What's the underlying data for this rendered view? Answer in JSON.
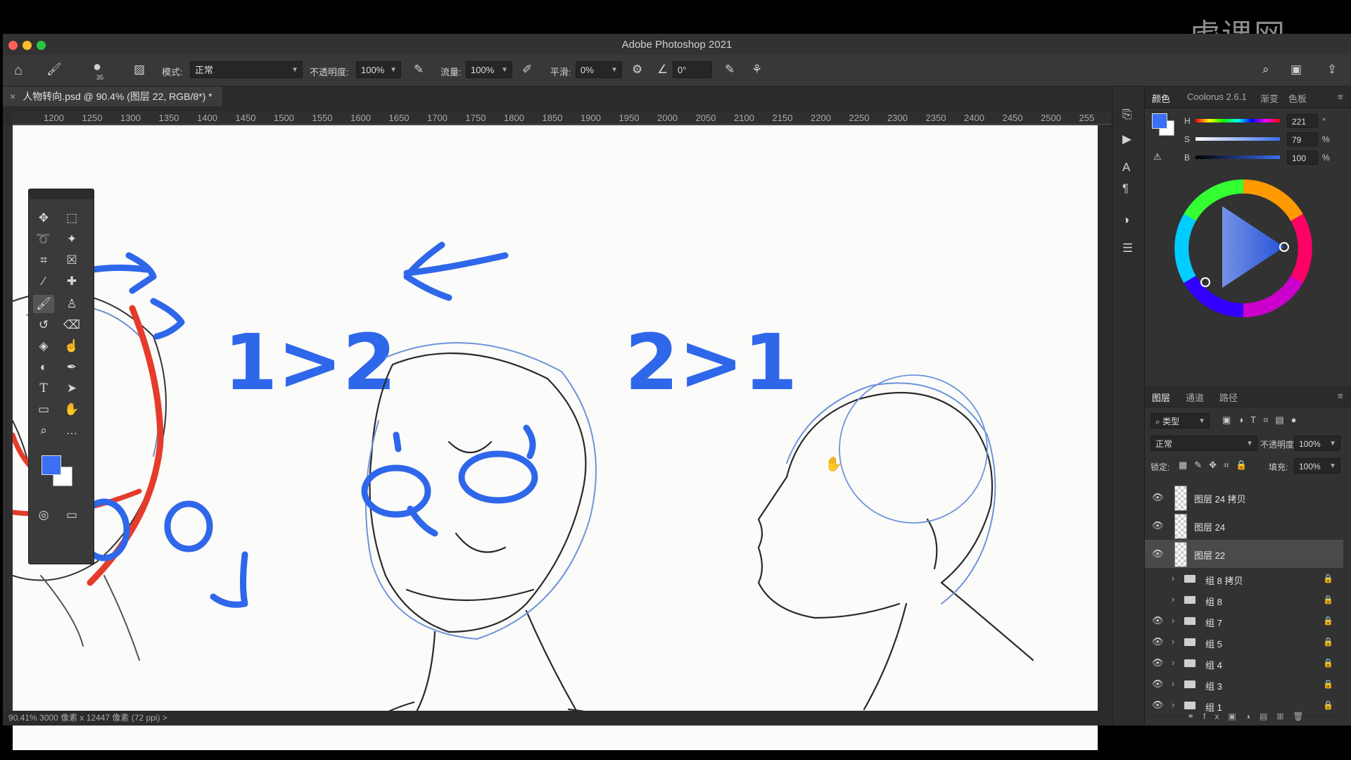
{
  "watermark": "虎课网",
  "app": {
    "title": "Adobe Photoshop 2021",
    "traffic_colors": [
      "#ff5f57",
      "#febc2e",
      "#28c840"
    ]
  },
  "options_bar": {
    "brush_size": "35",
    "mode_label": "模式:",
    "mode_value": "正常",
    "opacity_label": "不透明度:",
    "opacity_value": "100%",
    "flow_label": "流量:",
    "flow_value": "100%",
    "smoothing_label": "平滑:",
    "smoothing_value": "0%",
    "angle_value": "0°"
  },
  "document_tab": {
    "close": "×",
    "label": "人物转向.psd @ 90.4% (图层 22, RGB/8*) *"
  },
  "ruler": {
    "ticks": [
      "1200",
      "1250",
      "1300",
      "1350",
      "1400",
      "1450",
      "1500",
      "1550",
      "1600",
      "1650",
      "1700",
      "1750",
      "1800",
      "1850",
      "1900",
      "1950",
      "2000",
      "2050",
      "2100",
      "2150",
      "2200",
      "2250",
      "2300",
      "2350",
      "2400",
      "2450",
      "2500",
      "255"
    ]
  },
  "canvas": {
    "annotation_left": "1>2",
    "annotation_right": "2>1"
  },
  "status_bar": {
    "text": "90.41%   3000 像素 x 12447 像素 (72 ppi)  >"
  },
  "color_panel": {
    "tabs": [
      "颜色",
      "Coolorus 2.6.1",
      "渐变",
      "色板"
    ],
    "foreground": "#3b6ff5",
    "background": "#ffffff",
    "h_label": "H",
    "h_value": "221",
    "h_unit": "°",
    "s_label": "S",
    "s_value": "79",
    "s_unit": "%",
    "b_label": "B",
    "b_value": "100",
    "b_unit": "%"
  },
  "layers_panel": {
    "tabs": [
      "图层",
      "通道",
      "路径"
    ],
    "filter_label": "类型",
    "blend_mode": "正常",
    "opacity_label": "不透明度:",
    "opacity_value": "100%",
    "lock_label": "锁定:",
    "fill_label": "填充:",
    "fill_value": "100%",
    "layers": [
      {
        "name": "图层 24 拷贝",
        "visible": true,
        "type": "layer",
        "selected": false
      },
      {
        "name": "图层 24",
        "visible": true,
        "type": "layer",
        "selected": false
      },
      {
        "name": "图层 22",
        "visible": true,
        "type": "layer",
        "selected": true
      },
      {
        "name": "组 8 拷贝",
        "visible": false,
        "type": "group",
        "locked": true
      },
      {
        "name": "组 8",
        "visible": false,
        "type": "group",
        "locked": true
      },
      {
        "name": "组 7",
        "visible": true,
        "type": "group",
        "locked": true
      },
      {
        "name": "组 5",
        "visible": true,
        "type": "group",
        "locked": true
      },
      {
        "name": "组 4",
        "visible": true,
        "type": "group",
        "locked": true
      },
      {
        "name": "组 3",
        "visible": true,
        "type": "group",
        "locked": true
      },
      {
        "name": "组 1",
        "visible": true,
        "type": "group",
        "locked": true
      }
    ]
  }
}
